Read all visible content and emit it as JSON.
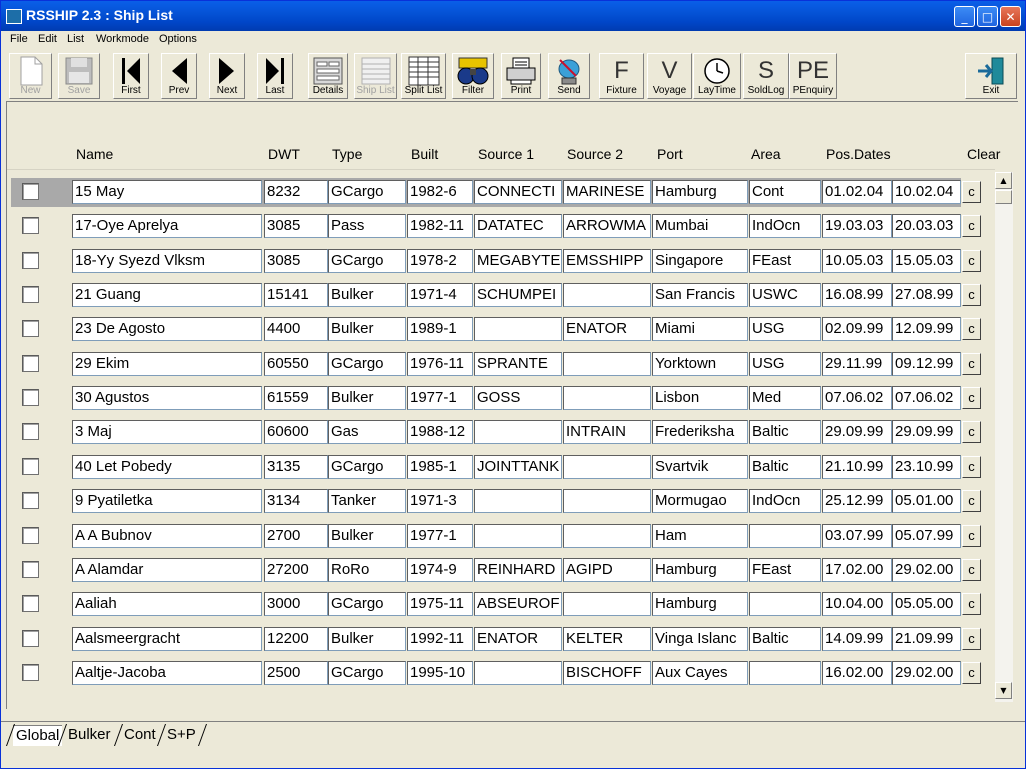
{
  "window": {
    "title": "RSSHIP 2.3 : Ship List",
    "minimize_glyph": "_",
    "maximize_glyph": "□",
    "close_glyph": "✕"
  },
  "menu": [
    "File",
    "Edit",
    "List",
    "Workmode",
    "Options"
  ],
  "toolbar": [
    {
      "label": "New",
      "icon": "new-document-icon",
      "enabled": false
    },
    {
      "label": "Save",
      "icon": "floppy-disk-icon",
      "enabled": false
    },
    {
      "label": "First",
      "icon": "first-record-icon",
      "enabled": true
    },
    {
      "label": "Prev",
      "icon": "previous-icon",
      "enabled": true
    },
    {
      "label": "Next",
      "icon": "next-icon",
      "enabled": true
    },
    {
      "label": "Last",
      "icon": "last-record-icon",
      "enabled": true
    },
    {
      "label": "Details",
      "icon": "details-form-icon",
      "enabled": true
    },
    {
      "label": "Ship List",
      "icon": "ship-list-icon",
      "enabled": false
    },
    {
      "label": "Split List",
      "icon": "split-list-icon",
      "enabled": true
    },
    {
      "label": "Filter",
      "icon": "binoculars-icon",
      "enabled": true
    },
    {
      "label": "Print",
      "icon": "printer-icon",
      "enabled": true
    },
    {
      "label": "Send",
      "icon": "satellite-dish-icon",
      "enabled": true
    },
    {
      "label": "Fixture",
      "icon": "letter-f-icon",
      "glyph": "F",
      "enabled": true
    },
    {
      "label": "Voyage",
      "icon": "letter-v-icon",
      "glyph": "V",
      "enabled": true
    },
    {
      "label": "LayTime",
      "icon": "clock-icon",
      "enabled": true
    },
    {
      "label": "SoldLog",
      "icon": "letter-s-icon",
      "glyph": "S",
      "enabled": true
    },
    {
      "label": "PEnquiry",
      "icon": "letter-pe-icon",
      "glyph": "PE",
      "enabled": true
    },
    {
      "label": "Exit",
      "icon": "exit-door-icon",
      "enabled": true
    }
  ],
  "table": {
    "columns": [
      "Name",
      "DWT",
      "Type",
      "Built",
      "Source 1",
      "Source 2",
      "Port",
      "Area",
      "Pos.Dates",
      "Clear"
    ],
    "clear_label": "c",
    "selected_row": 0,
    "rows": [
      {
        "name": "15 May",
        "dwt": "8232",
        "type": "GCargo",
        "built": "1982-6",
        "source1": "CONNECTI",
        "source2": "MARINESE",
        "port": "Hamburg",
        "area": "Cont",
        "pos_from": "01.02.04",
        "pos_to": "10.02.04"
      },
      {
        "name": "17-Oye Aprelya",
        "dwt": "3085",
        "type": "Pass",
        "built": "1982-11",
        "source1": "DATATEC",
        "source2": "ARROWMA",
        "port": "Mumbai",
        "area": "IndOcn",
        "pos_from": "19.03.03",
        "pos_to": "20.03.03"
      },
      {
        "name": "18-Yy Syezd Vlksm",
        "dwt": "3085",
        "type": "GCargo",
        "built": "1978-2",
        "source1": "MEGABYTE",
        "source2": "EMSSHIPP",
        "port": "Singapore",
        "area": "FEast",
        "pos_from": "10.05.03",
        "pos_to": "15.05.03"
      },
      {
        "name": "21 Guang",
        "dwt": "15141",
        "type": "Bulker",
        "built": "1971-4",
        "source1": "SCHUMPEI",
        "source2": "",
        "port": "San Francis",
        "area": "USWC",
        "pos_from": "16.08.99",
        "pos_to": "27.08.99"
      },
      {
        "name": "23 De Agosto",
        "dwt": "4400",
        "type": "Bulker",
        "built": "1989-1",
        "source1": "",
        "source2": "ENATOR",
        "port": "Miami",
        "area": "USG",
        "pos_from": "02.09.99",
        "pos_to": "12.09.99"
      },
      {
        "name": "29 Ekim",
        "dwt": "60550",
        "type": "GCargo",
        "built": "1976-11",
        "source1": "SPRANTE",
        "source2": "",
        "port": "Yorktown",
        "area": "USG",
        "pos_from": "29.11.99",
        "pos_to": "09.12.99"
      },
      {
        "name": "30 Agustos",
        "dwt": "61559",
        "type": "Bulker",
        "built": "1977-1",
        "source1": "GOSS",
        "source2": "",
        "port": "Lisbon",
        "area": "Med",
        "pos_from": "07.06.02",
        "pos_to": "07.06.02"
      },
      {
        "name": "3 Maj",
        "dwt": "60600",
        "type": "Gas",
        "built": "1988-12",
        "source1": "",
        "source2": "INTRAIN",
        "port": "Frederiksha",
        "area": "Baltic",
        "pos_from": "29.09.99",
        "pos_to": "29.09.99"
      },
      {
        "name": "40 Let Pobedy",
        "dwt": "3135",
        "type": "GCargo",
        "built": "1985-1",
        "source1": "JOINTTANK",
        "source2": "",
        "port": "Svartvik",
        "area": "Baltic",
        "pos_from": "21.10.99",
        "pos_to": "23.10.99"
      },
      {
        "name": "9 Pyatiletka",
        "dwt": "3134",
        "type": "Tanker",
        "built": "1971-3",
        "source1": "",
        "source2": "",
        "port": "Mormugao",
        "area": "IndOcn",
        "pos_from": "25.12.99",
        "pos_to": "05.01.00"
      },
      {
        "name": "A A Bubnov",
        "dwt": "2700",
        "type": "Bulker",
        "built": "1977-1",
        "source1": "",
        "source2": "",
        "port": "Ham",
        "area": "",
        "pos_from": "03.07.99",
        "pos_to": "05.07.99"
      },
      {
        "name": "A Alamdar",
        "dwt": "27200",
        "type": "RoRo",
        "built": "1974-9",
        "source1": "REINHARD",
        "source2": "AGIPD",
        "port": "Hamburg",
        "area": "FEast",
        "pos_from": "17.02.00",
        "pos_to": "29.02.00"
      },
      {
        "name": "Aaliah",
        "dwt": "3000",
        "type": "GCargo",
        "built": "1975-11",
        "source1": "ABSEUROF",
        "source2": "",
        "port": "Hamburg",
        "area": "",
        "pos_from": "10.04.00",
        "pos_to": "05.05.00"
      },
      {
        "name": "Aalsmeergracht",
        "dwt": "12200",
        "type": "Bulker",
        "built": "1992-11",
        "source1": "ENATOR",
        "source2": "KELTER",
        "port": "Vinga Islanc",
        "area": "Baltic",
        "pos_from": "14.09.99",
        "pos_to": "21.09.99"
      },
      {
        "name": "Aaltje-Jacoba",
        "dwt": "2500",
        "type": "GCargo",
        "built": "1995-10",
        "source1": "",
        "source2": "BISCHOFF",
        "port": "Aux Cayes",
        "area": "",
        "pos_from": "16.02.00",
        "pos_to": "29.02.00"
      }
    ]
  },
  "scrollbar": {
    "up_glyph": "▲",
    "down_glyph": "▼"
  },
  "tabs": [
    "Global",
    "Bulker",
    "Cont",
    "S+P"
  ],
  "active_tab": "Global"
}
